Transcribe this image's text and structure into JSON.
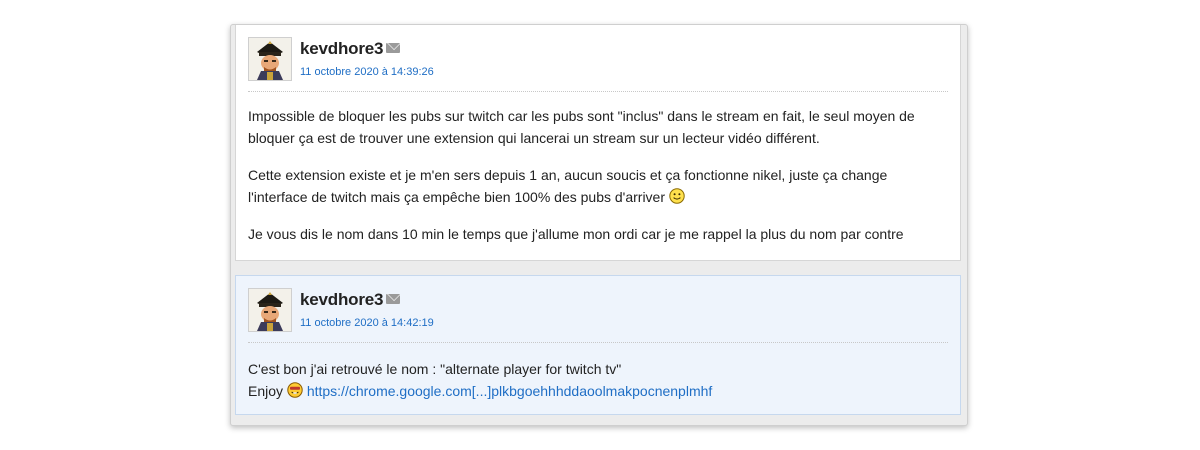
{
  "posts": [
    {
      "username": "kevdhore3",
      "date": "11 octobre 2020 à 14:39:26",
      "paragraphs": [
        "Impossible de bloquer les pubs sur twitch car les pubs sont \"inclus\" dans le stream en fait, le seul moyen de bloquer ça est de trouver une extension qui lancerai un stream sur un lecteur vidéo différent.",
        "Cette extension existe et je m'en sers depuis 1 an, aucun soucis et ça fonctionne nikel, juste ça change l'interface de twitch mais ça empêche bien 100% des pubs d'arriver",
        "Je vous dis le nom dans 10 min le temps que j'allume mon ordi car je me rappel la plus du nom par contre"
      ],
      "smiley": "smile-icon"
    },
    {
      "username": "kevdhore3",
      "date": "11 octobre 2020 à 14:42:19",
      "line1": "C'est bon j'ai retrouvé le nom : \"alternate player for twitch tv\"",
      "line2_prefix": "Enjoy",
      "smiley": "cool-smiley-icon",
      "link_text": "https://chrome.google.com[...]plkbgoehhhddaoolmakpocnenplmhf"
    }
  ],
  "colors": {
    "link": "#1f6ec5",
    "second_post_bg": "#eef4fc"
  }
}
